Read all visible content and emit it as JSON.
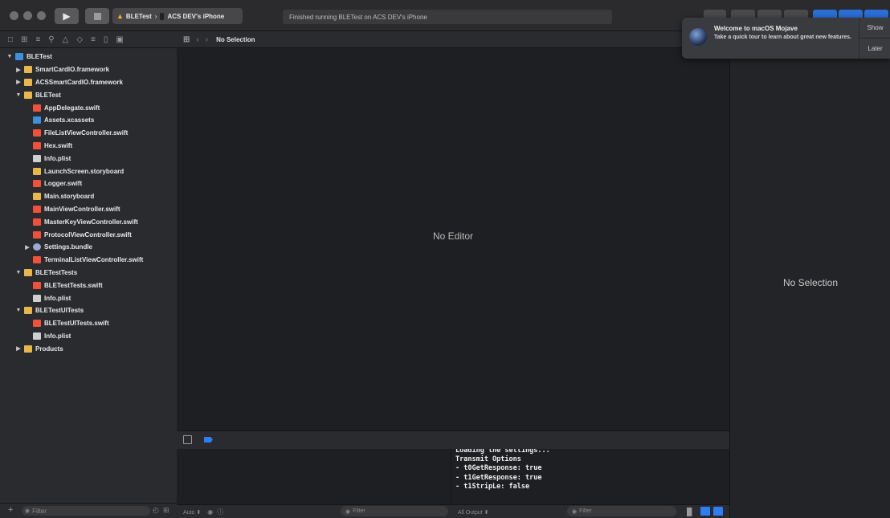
{
  "toolbar": {
    "scheme_target": "BLETest",
    "scheme_device": "ACS DEV's iPhone",
    "status": "Finished running BLETest on ACS DEV's iPhone"
  },
  "navigator": {
    "tree": [
      {
        "label": "BLETest",
        "indent": 0,
        "icon": "project",
        "disclosure": "open"
      },
      {
        "label": "SmartCardIO.framework",
        "indent": 1,
        "icon": "folder",
        "disclosure": "closed"
      },
      {
        "label": "ACSSmartCardIO.framework",
        "indent": 1,
        "icon": "folder",
        "disclosure": "closed"
      },
      {
        "label": "BLETest",
        "indent": 1,
        "icon": "folder",
        "disclosure": "open"
      },
      {
        "label": "AppDelegate.swift",
        "indent": 2,
        "icon": "swift",
        "disclosure": ""
      },
      {
        "label": "Assets.xcassets",
        "indent": 2,
        "icon": "assets",
        "disclosure": ""
      },
      {
        "label": "FileListViewController.swift",
        "indent": 2,
        "icon": "swift",
        "disclosure": ""
      },
      {
        "label": "Hex.swift",
        "indent": 2,
        "icon": "swift",
        "disclosure": ""
      },
      {
        "label": "Info.plist",
        "indent": 2,
        "icon": "plist",
        "disclosure": ""
      },
      {
        "label": "LaunchScreen.storyboard",
        "indent": 2,
        "icon": "storyboard",
        "disclosure": ""
      },
      {
        "label": "Logger.swift",
        "indent": 2,
        "icon": "swift",
        "disclosure": ""
      },
      {
        "label": "Main.storyboard",
        "indent": 2,
        "icon": "storyboard",
        "disclosure": ""
      },
      {
        "label": "MainViewController.swift",
        "indent": 2,
        "icon": "swift",
        "disclosure": ""
      },
      {
        "label": "MasterKeyViewController.swift",
        "indent": 2,
        "icon": "swift",
        "disclosure": ""
      },
      {
        "label": "ProtocolViewController.swift",
        "indent": 2,
        "icon": "swift",
        "disclosure": ""
      },
      {
        "label": "Settings.bundle",
        "indent": 2,
        "icon": "bundle",
        "disclosure": "closed"
      },
      {
        "label": "TerminalListViewController.swift",
        "indent": 2,
        "icon": "swift",
        "disclosure": ""
      },
      {
        "label": "BLETestTests",
        "indent": 1,
        "icon": "folder",
        "disclosure": "open"
      },
      {
        "label": "BLETestTests.swift",
        "indent": 2,
        "icon": "swift",
        "disclosure": ""
      },
      {
        "label": "Info.plist",
        "indent": 2,
        "icon": "plist",
        "disclosure": ""
      },
      {
        "label": "BLETestUITests",
        "indent": 1,
        "icon": "folder",
        "disclosure": "open"
      },
      {
        "label": "BLETestUITests.swift",
        "indent": 2,
        "icon": "swift",
        "disclosure": ""
      },
      {
        "label": "Info.plist",
        "indent": 2,
        "icon": "plist",
        "disclosure": ""
      },
      {
        "label": "Products",
        "indent": 1,
        "icon": "folder",
        "disclosure": "closed"
      }
    ],
    "filter_placeholder": "Filter"
  },
  "editor": {
    "jump_label": "No Selection",
    "placeholder": "No Editor"
  },
  "debug": {
    "vars_mode": "Auto ⬍",
    "vars_filter": "Filter",
    "output_mode": "All Output ⬍",
    "console_filter": "Filter",
    "console_lines": [
      "Loading the settings...",
      "Transmit Options",
      "- t0GetResponse: true",
      "- t1GetResponse: true",
      "- t1StripLe: false"
    ]
  },
  "inspector": {
    "placeholder": "No Selection"
  },
  "notification": {
    "title": "Welcome to macOS Mojave",
    "body": "Take a quick tour to learn about great new features.",
    "show_label": "Show",
    "later_label": "Later"
  }
}
